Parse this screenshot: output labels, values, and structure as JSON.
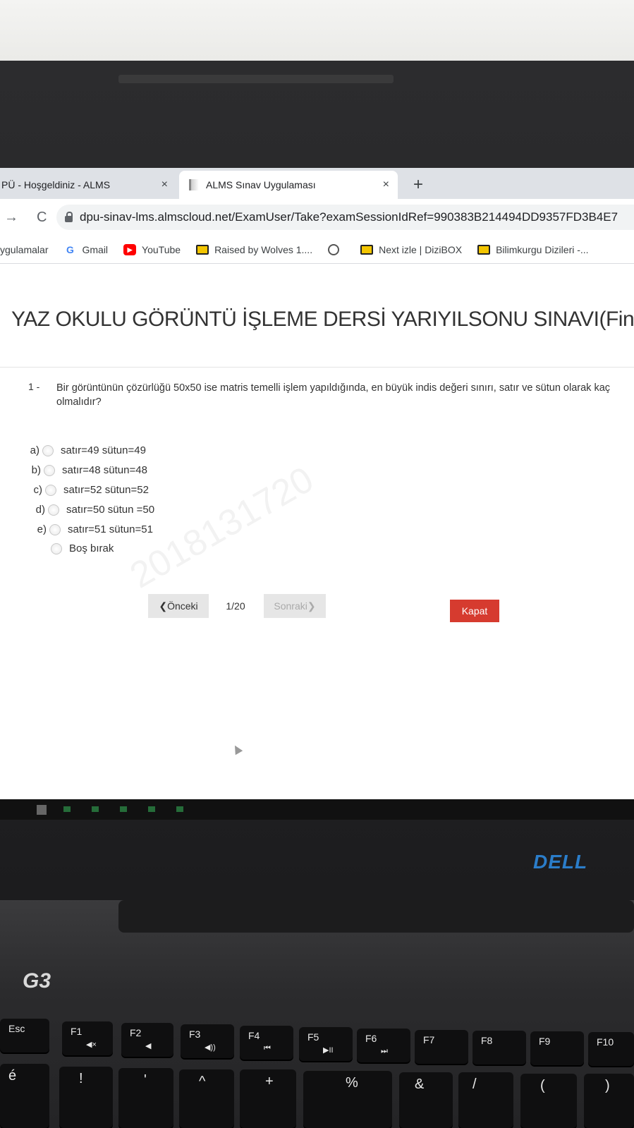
{
  "browser": {
    "tabs": [
      {
        "title": "PÜ - Hoşgeldiniz - ALMS",
        "close": "×"
      },
      {
        "title": "ALMS Sınav Uygulaması",
        "close": "×"
      }
    ],
    "new_tab": "+",
    "url": "dpu-sinav-lms.almscloud.net/ExamUser/Take?examSessionIdRef=990383B214494DD9357FD3B4E7",
    "nav": {
      "back": "→",
      "reload": "C"
    },
    "bookmarks": [
      {
        "label": "ygulamalar",
        "icon": "apps-icon"
      },
      {
        "label": "Gmail",
        "icon": "google-icon"
      },
      {
        "label": "YouTube",
        "icon": "youtube-icon"
      },
      {
        "label": "Raised by Wolves 1....",
        "icon": "tv-icon"
      },
      {
        "label": "",
        "icon": "globe-icon"
      },
      {
        "label": "Next izle | DiziBOX",
        "icon": "tv-icon"
      },
      {
        "label": "Bilimkurgu Dizileri -...",
        "icon": "tv-icon"
      }
    ]
  },
  "exam": {
    "title": "YAZ OKULU GÖRÜNTÜ İŞLEME DERSİ YARIYILSONU SINAVI(Final)",
    "question_number": "1 -",
    "question_text": "Bir görüntünün çözürlüğü 50x50 ise matris temelli işlem yapıldığında, en büyük indis değeri sınırı, satır ve sütun olarak kaç olmalıdır?",
    "options": [
      {
        "letter": "a)",
        "text": "satır=49 sütun=49"
      },
      {
        "letter": "b)",
        "text": "satır=48 sütun=48"
      },
      {
        "letter": "c)",
        "text": "satır=52 sütun=52"
      },
      {
        "letter": "d)",
        "text": "satır=50 sütun =50"
      },
      {
        "letter": "e)",
        "text": "satır=51 sütun=51"
      },
      {
        "letter": "",
        "text": "Boş bırak"
      }
    ],
    "watermark": "2018131720",
    "prev_label": "❮Önceki",
    "page_indicator": "1/20",
    "next_label": "Sonraki❯",
    "close_label": "Kapat"
  },
  "device": {
    "brand": "DELL",
    "model": "G3",
    "keys": [
      {
        "main": "Esc",
        "sub": ""
      },
      {
        "main": "F1",
        "sub": "◀×"
      },
      {
        "main": "F2",
        "sub": "◀"
      },
      {
        "main": "F3",
        "sub": "◀))"
      },
      {
        "main": "F4",
        "sub": "⏮"
      },
      {
        "main": "F5",
        "sub": "▶II"
      },
      {
        "main": "F6",
        "sub": "⏭"
      },
      {
        "main": "F7",
        "sub": ""
      },
      {
        "main": "F8",
        "sub": ""
      },
      {
        "main": "F9",
        "sub": ""
      },
      {
        "main": "F10",
        "sub": ""
      }
    ],
    "row2": [
      "é",
      "!",
      "'",
      "^",
      "+",
      "%",
      "&",
      "/",
      "(",
      ")"
    ]
  },
  "colors": {
    "close_button": "#d63b2f",
    "dell_blue": "#2b7dc9"
  }
}
